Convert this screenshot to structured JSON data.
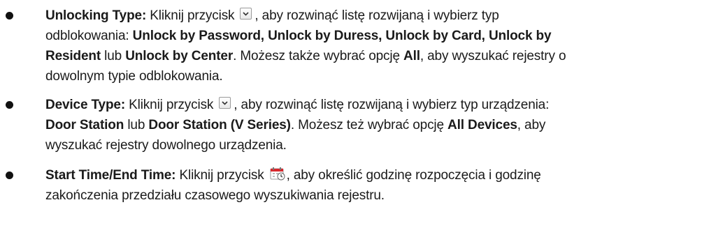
{
  "items": [
    {
      "lines": [
        {
          "b1": "Unlocking Type:",
          "t1": " Kliknij przycisk",
          "t2": ", aby rozwinąć listę rozwijaną i wybierz typ"
        },
        {
          "t1": "odblokowania: ",
          "b1": "Unlock by Password, Unlock by Duress, Unlock by Card, Unlock by"
        },
        {
          "b1": "Resident",
          "t1": " lub ",
          "b2": "Unlock by Center",
          "t2": ". Możesz także wybrać opcję ",
          "b3": "All",
          "t3": ", aby wyszukać rejestry o"
        },
        {
          "t1": "dowolnym typie odblokowania."
        }
      ],
      "icon": "dropdown-arrow-icon"
    },
    {
      "lines": [
        {
          "b1": "Device Type:",
          "t1": " Kliknij przycisk",
          "t2": ", aby rozwinąć listę rozwijaną i wybierz typ urządzenia:"
        },
        {
          "b1": "Door Station",
          "t1": " lub ",
          "b2": "Door Station (V Series)",
          "t2": ". Możesz też wybrać opcję ",
          "b3": "All Devices",
          "t3": ", aby"
        },
        {
          "t1": "wyszukać rejestry dowolnego urządzenia."
        }
      ],
      "icon": "dropdown-arrow-icon"
    },
    {
      "lines": [
        {
          "b1": "Start Time/End Time:",
          "t1": " Kliknij przycisk",
          "t2": ", aby określić godzinę rozpoczęcia i godzinę"
        },
        {
          "t1": "zakończenia przedziału czasowego wyszukiwania rejestru."
        }
      ],
      "icon": "calendar-icon"
    }
  ],
  "colors": {
    "text": "#1a1a1a",
    "calendar_accent": "#d9262b"
  }
}
